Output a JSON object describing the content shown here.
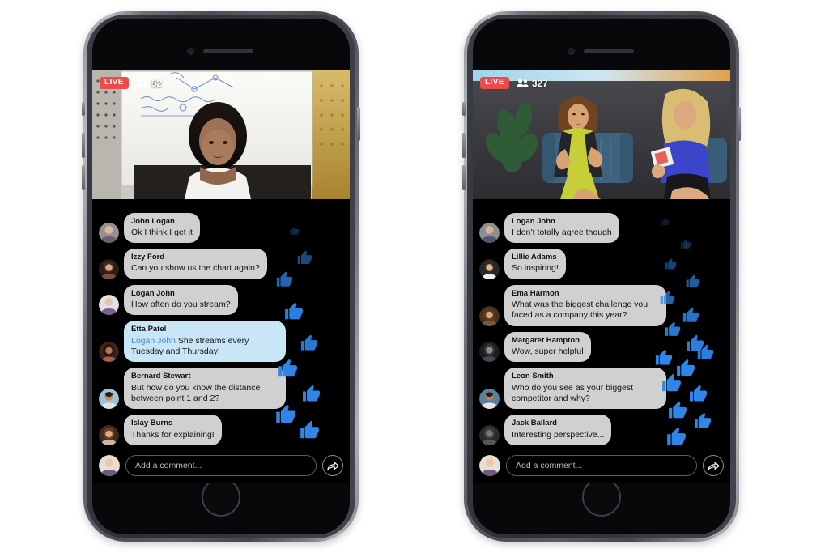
{
  "phones": [
    {
      "id": "left",
      "stream": {
        "live_label": "LIVE",
        "viewer_count": "52",
        "viewers_icon": "people-icon",
        "scene": "classroom-whiteboard-presenter"
      },
      "messages": [
        {
          "author": "John Logan",
          "text": "Ok I think I get it",
          "highlight": false
        },
        {
          "author": "Izzy Ford",
          "text": "Can you show us the chart again?",
          "highlight": false
        },
        {
          "author": "Logan John",
          "text": "How often do you stream?",
          "highlight": false
        },
        {
          "author": "Etta Patel",
          "mention": "Logan John",
          "text": "She streams every Tuesday and Thursday!",
          "highlight": true
        },
        {
          "author": "Bernard Stewart",
          "text": "But how do you know the distance between point 1 and 2?",
          "highlight": false
        },
        {
          "author": "Islay Burns",
          "text": "Thanks for explaining!",
          "highlight": false
        }
      ],
      "composer": {
        "placeholder": "Add a comment...",
        "share_icon": "share-arrow-icon",
        "avatar_icon": "user-avatar"
      },
      "reaction_count": 10
    },
    {
      "id": "right",
      "stream": {
        "live_label": "LIVE",
        "viewer_count": "327",
        "viewers_icon": "people-icon",
        "scene": "interview-two-women-armchairs"
      },
      "messages": [
        {
          "author": "Logan John",
          "text": "I don’t totally agree though",
          "highlight": false
        },
        {
          "author": "Lillie Adams",
          "text": "So inspiring!",
          "highlight": false
        },
        {
          "author": "Ema Harmon",
          "text": "What was the biggest challenge you faced as a company this year?",
          "highlight": false
        },
        {
          "author": "Margaret Hampton",
          "text": "Wow, super helpful",
          "highlight": false
        },
        {
          "author": "Leon Smith",
          "text": "Who do you see as your biggest competitor and why?",
          "highlight": false
        },
        {
          "author": "Jack Ballard",
          "text": "Interesting perspective...",
          "highlight": false
        }
      ],
      "composer": {
        "placeholder": "Add a comment...",
        "share_icon": "share-arrow-icon",
        "avatar_icon": "user-avatar"
      },
      "reaction_count": 22
    }
  ],
  "colors": {
    "live_red": "#ef4a4a",
    "bubble_gray": "#d0d0d0",
    "bubble_highlight": "#c9e6f7",
    "mention_blue": "#3b8fd4",
    "reaction_blue": "#2e86e8",
    "screen_black": "#000000"
  }
}
